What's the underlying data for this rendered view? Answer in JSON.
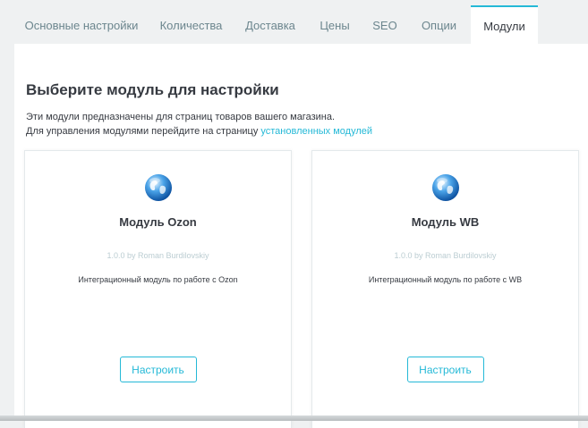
{
  "tabs": [
    {
      "label": "Основные настройки"
    },
    {
      "label": "Количества"
    },
    {
      "label": "Доставка"
    },
    {
      "label": "Цены"
    },
    {
      "label": "SEO"
    },
    {
      "label": "Опции"
    },
    {
      "label": "Модули",
      "active": true
    }
  ],
  "main": {
    "heading": "Выберите модуль для настройки",
    "description_line1": "Эти модули предназначены для страниц товаров вашего магазина.",
    "description_line2_prefix": "Для управления модулями перейдите на страницу ",
    "description_link": "установленных модулей"
  },
  "modules": [
    {
      "icon": "globe-icon",
      "title": "Модуль Ozon",
      "version": "1.0.0 by Roman Burdilovskiy",
      "description": "Интеграционный модуль по работе с Ozon",
      "button": "Настроить"
    },
    {
      "icon": "globe-icon",
      "title": "Модуль WB",
      "version": "1.0.0 by Roman Burdilovskiy",
      "description": "Интеграционный модуль по работе с WB",
      "button": "Настроить"
    }
  ],
  "colors": {
    "accent": "#25b9d7",
    "background": "#eff1f2",
    "text": "#363a41",
    "muted": "#bbcdd2"
  }
}
